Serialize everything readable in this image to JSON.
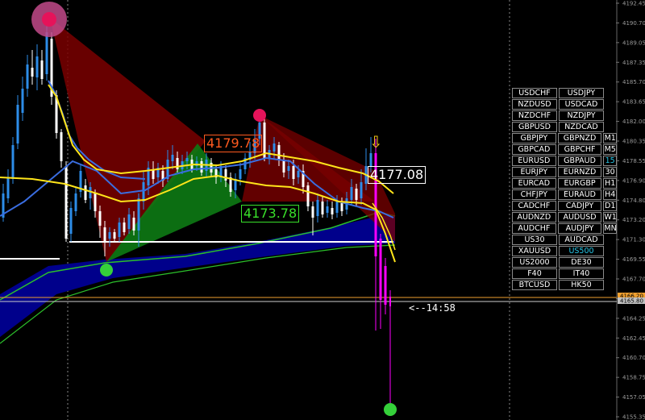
{
  "chart": {
    "price_axis": [
      "4192.45",
      "4190.70",
      "4189.05",
      "4187.35",
      "4185.70",
      "4183.65",
      "4182.00",
      "4180.35",
      "4178.55",
      "4176.90",
      "4174.80",
      "4173.20",
      "4171.30",
      "4169.55",
      "4167.70",
      "4165.80",
      "4164.25",
      "4162.45",
      "4160.70",
      "4158.75",
      "4157.05",
      "4155.35"
    ],
    "price_tags": [
      {
        "text": "4166.20",
        "color": "#f0a030"
      },
      {
        "text": "4165.80",
        "color": "#c0c0c0"
      }
    ],
    "pattern_labels": {
      "upper": "4179.78",
      "lower": "4173.78",
      "current": "4177.08"
    },
    "countdown": "<--14:58",
    "signal_arrow": "⇩",
    "colors": {
      "bull_candle": "#2d8de8",
      "bear_candle": "#ffffff",
      "spike_candle": "#ff00ff",
      "yellow_ma": "#ffe51a",
      "blue_ma": "#3a6de0",
      "green_ma": "#2bbf2b",
      "band": "#00008b",
      "pattern_red": "#7a0000",
      "pattern_green": "#0d7a14"
    }
  },
  "symbols": {
    "rows": [
      {
        "a": "USDCHF",
        "b": "USDJPY",
        "tf": ""
      },
      {
        "a": "NZDUSD",
        "b": "USDCAD",
        "tf": ""
      },
      {
        "a": "NZDCHF",
        "b": "NZDJPY",
        "tf": ""
      },
      {
        "a": "GBPUSD",
        "b": "NZDCAD",
        "tf": ""
      },
      {
        "a": "GBPJPY",
        "b": "GBPNZD",
        "tf": "M1"
      },
      {
        "a": "GBPCAD",
        "b": "GBPCHF",
        "tf": "M5"
      },
      {
        "a": "EURUSD",
        "b": "GBPAUD",
        "tf": "15"
      },
      {
        "a": "EURJPY",
        "b": "EURNZD",
        "tf": "30"
      },
      {
        "a": "EURCAD",
        "b": "EURGBP",
        "tf": "H1"
      },
      {
        "a": "CHFJPY",
        "b": "EURAUD",
        "tf": "H4"
      },
      {
        "a": "CADCHF",
        "b": "CADJPY",
        "tf": "D1"
      },
      {
        "a": "AUDNZD",
        "b": "AUDUSD",
        "tf": "W1"
      },
      {
        "a": "AUDCHF",
        "b": "AUDJPY",
        "tf": "MN"
      },
      {
        "a": "US30",
        "b": "AUDCAD",
        "tf": ""
      },
      {
        "a": "XAUUSD",
        "b": "US500",
        "tf": ""
      },
      {
        "a": "US2000",
        "b": "DE30",
        "tf": ""
      },
      {
        "a": "F40",
        "b": "IT40",
        "tf": ""
      },
      {
        "a": "BTCUSD",
        "b": "HK50",
        "tf": ""
      }
    ],
    "active_symbol": "US500",
    "active_timeframe": "15"
  }
}
